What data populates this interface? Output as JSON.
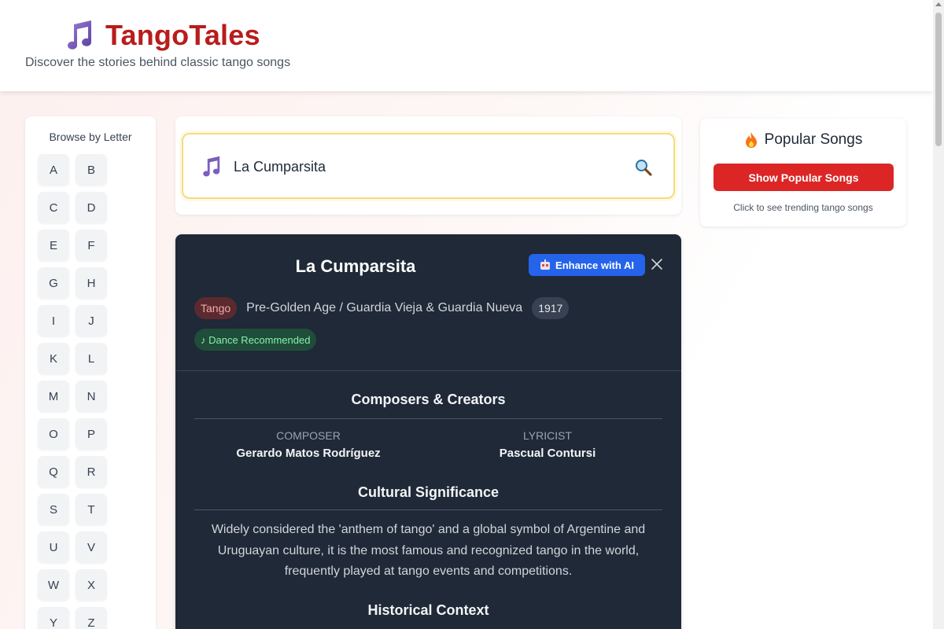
{
  "header": {
    "title": "TangoTales",
    "tagline": "Discover the stories behind classic tango songs",
    "logo_icon": "musical-notes-icon"
  },
  "sidebar": {
    "title": "Browse by Letter",
    "letters": [
      "A",
      "B",
      "C",
      "D",
      "E",
      "F",
      "G",
      "H",
      "I",
      "J",
      "K",
      "L",
      "M",
      "N",
      "O",
      "P",
      "Q",
      "R",
      "S",
      "T",
      "U",
      "V",
      "W",
      "X",
      "Y",
      "Z"
    ]
  },
  "search": {
    "value": "La Cumparsita",
    "placeholder": ""
  },
  "popular": {
    "title": "Popular Songs",
    "button_label": "Show Popular Songs",
    "hint": "Click to see trending tango songs"
  },
  "song": {
    "title": "La Cumparsita",
    "enhance_label": "Enhance with AI",
    "genre": "Tango",
    "era": "Pre-Golden Age / Guardia Vieja & Guardia Nueva",
    "year": "1917",
    "dance_badge": "♪ Dance Recommended",
    "composers_heading": "Composers & Creators",
    "composer_role": "COMPOSER",
    "composer_name": "Gerardo Matos Rodríguez",
    "lyricist_role": "LYRICIST",
    "lyricist_name": "Pascual Contursi",
    "cultural_heading": "Cultural Significance",
    "cultural_text": "Widely considered the 'anthem of tango' and a global symbol of Argentine and Uruguayan culture, it is the most famous and recognized tango in the world, frequently played at tango events and competitions.",
    "historical_heading": "Historical Context"
  },
  "colors": {
    "brand": "#b91c1c",
    "primary_button": "#dc2626",
    "ai_button": "#2563eb",
    "card_dark": "#1f2937"
  }
}
